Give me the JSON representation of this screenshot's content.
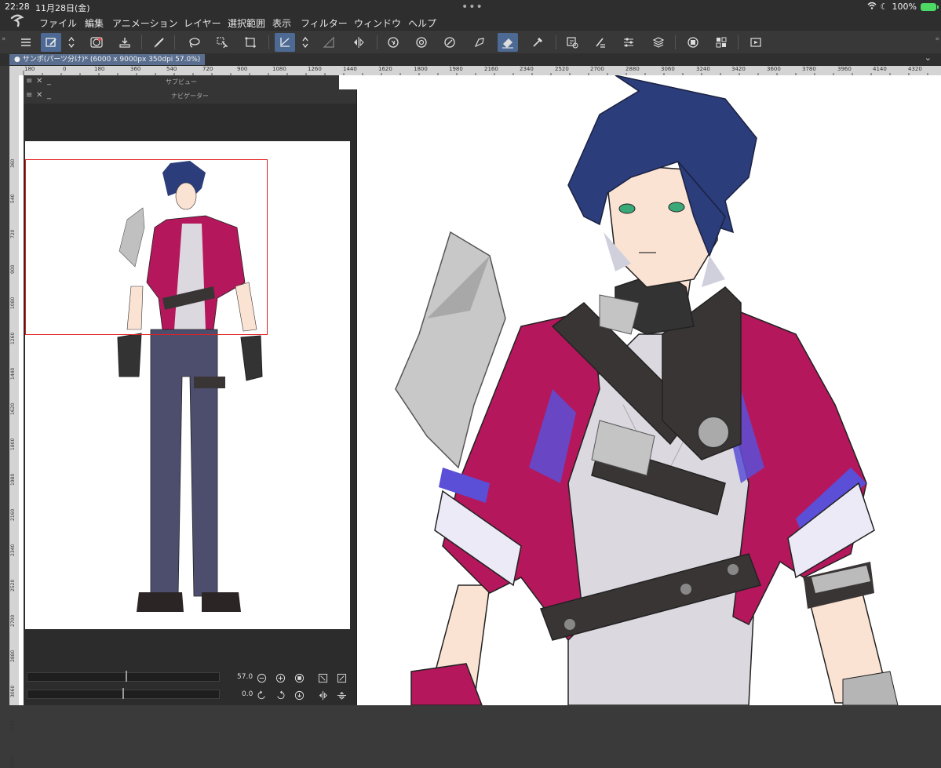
{
  "status": {
    "time": "22:28",
    "date": "11月28日(金)",
    "battery": "100%"
  },
  "menu": [
    "ファイル",
    "編集",
    "アニメーション",
    "レイヤー",
    "選択範囲",
    "表示",
    "フィルター",
    "ウィンドウ",
    "ヘルプ"
  ],
  "tab": {
    "title": "サンポ(パーツ分け)* (6000 x 9000px 350dpi 57.0%)"
  },
  "ruler_top": [
    "180",
    "0",
    "180",
    "360",
    "540",
    "720",
    "900",
    "1080",
    "1260",
    "1440",
    "1620",
    "1800",
    "1980",
    "2160",
    "2340",
    "2520",
    "2700",
    "2880",
    "3060",
    "3240",
    "3420",
    "3600",
    "3780",
    "3960",
    "4140",
    "4320"
  ],
  "ruler_left": [
    "360",
    "540",
    "720",
    "900",
    "1080",
    "1260",
    "1440",
    "1620",
    "1800",
    "1980",
    "2160",
    "2340",
    "2520",
    "2700",
    "2880",
    "3060",
    "3240",
    "3420"
  ],
  "palettes": {
    "subview_title": "サブビュー",
    "navigator_title": "ナビゲーター"
  },
  "navigator": {
    "zoom": "57.0",
    "rotation": "0.0"
  },
  "colors": {
    "accent": "#4d6a95",
    "jacket": "#b5175c",
    "hair": "#2b3d7a",
    "trim": "#5a4fd6"
  }
}
